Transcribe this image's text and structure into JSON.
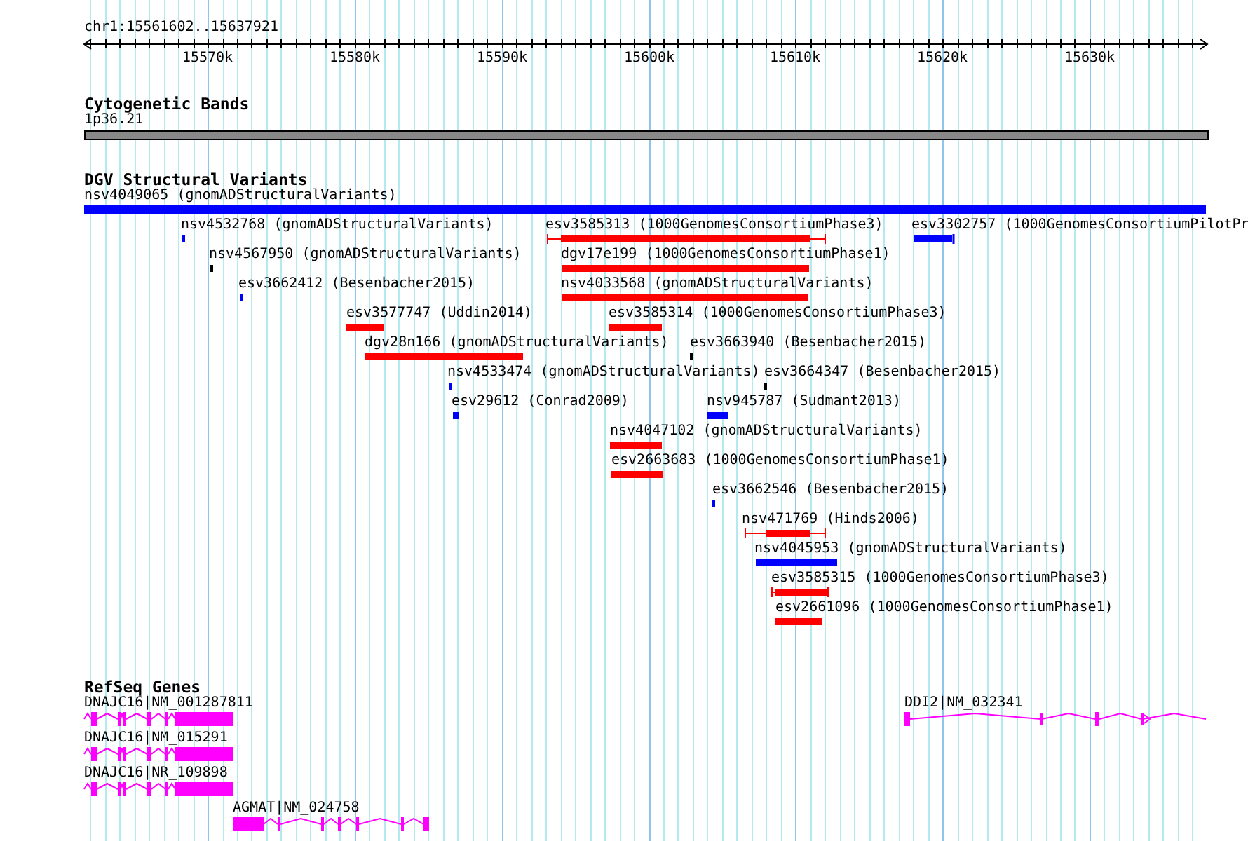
{
  "ruler": {
    "location": "chr1:15561602..15637921",
    "ticks": [
      "15570k",
      "15580k",
      "15590k",
      "15600k",
      "15610k",
      "15620k",
      "15630k"
    ]
  },
  "cytoband_track": {
    "title": "Cytogenetic Bands",
    "band": "1p36.21"
  },
  "variant_track": {
    "title": "DGV Structural Variants",
    "features": [
      {
        "label": "nsv4049065 (gnomADStructuralVariants)",
        "color": "#0000ff",
        "kind": "bar"
      },
      {
        "label": "nsv4532768 (gnomADStructuralVariants)",
        "color": "#0000ff",
        "kind": "bar"
      },
      {
        "label": "esv3585313 (1000GenomesConsortiumPhase3)",
        "color": "#ff0000",
        "kind": "whiskered"
      },
      {
        "label": "esv3302757 (1000GenomesConsortiumPilotPr",
        "color": "#0000ff",
        "kind": "capped"
      },
      {
        "label": "nsv4567950 (gnomADStructuralVariants)",
        "color": "#000000",
        "kind": "bar"
      },
      {
        "label": "dgv17e199 (1000GenomesConsortiumPhase1)",
        "color": "#ff0000",
        "kind": "bar"
      },
      {
        "label": "esv3662412 (Besenbacher2015)",
        "color": "#0000ff",
        "kind": "bar"
      },
      {
        "label": "nsv4033568 (gnomADStructuralVariants)",
        "color": "#ff0000",
        "kind": "bar"
      },
      {
        "label": "esv3577747 (Uddin2014)",
        "color": "#ff0000",
        "kind": "bar"
      },
      {
        "label": "esv3585314 (1000GenomesConsortiumPhase3)",
        "color": "#ff0000",
        "kind": "bar"
      },
      {
        "label": "dgv28n166 (gnomADStructuralVariants)",
        "color": "#ff0000",
        "kind": "bar"
      },
      {
        "label": "esv3663940 (Besenbacher2015)",
        "color": "#000000",
        "kind": "bar"
      },
      {
        "label": "nsv4533474 (gnomADStructuralVariants)",
        "color": "#0000ff",
        "kind": "bar"
      },
      {
        "label": "esv3664347 (Besenbacher2015)",
        "color": "#000000",
        "kind": "bar"
      },
      {
        "label": "esv29612 (Conrad2009)",
        "color": "#0000ff",
        "kind": "bar"
      },
      {
        "label": "nsv945787 (Sudmant2013)",
        "color": "#0000ff",
        "kind": "bar"
      },
      {
        "label": "nsv4047102 (gnomADStructuralVariants)",
        "color": "#ff0000",
        "kind": "bar"
      },
      {
        "label": "esv2663683 (1000GenomesConsortiumPhase1)",
        "color": "#ff0000",
        "kind": "bar"
      },
      {
        "label": "esv3662546 (Besenbacher2015)",
        "color": "#0000ff",
        "kind": "bar"
      },
      {
        "label": "nsv471769 (Hinds2006)",
        "color": "#ff0000",
        "kind": "whiskered"
      },
      {
        "label": "nsv4045953 (gnomADStructuralVariants)",
        "color": "#0000ff",
        "kind": "bar"
      },
      {
        "label": "esv3585315 (1000GenomesConsortiumPhase3)",
        "color": "#ff0000",
        "kind": "whiskered"
      },
      {
        "label": "esv2661096 (1000GenomesConsortiumPhase1)",
        "color": "#ff0000",
        "kind": "bar"
      }
    ]
  },
  "gene_track": {
    "title": "RefSeq Genes",
    "genes": [
      {
        "label": "DNAJC16|NM_001287811"
      },
      {
        "label": "DNAJC16|NM_015291"
      },
      {
        "label": "DNAJC16|NR_109898"
      },
      {
        "label": "AGMAT|NM_024758"
      },
      {
        "label": "DDI2|NM_032341"
      }
    ]
  }
}
